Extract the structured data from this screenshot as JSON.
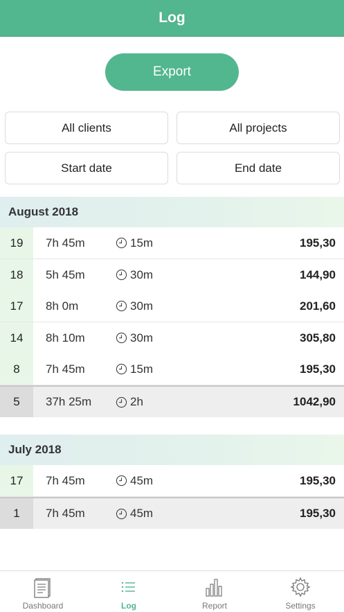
{
  "header": {
    "title": "Log"
  },
  "export_label": "Export",
  "filters": {
    "clients": "All clients",
    "projects": "All projects",
    "start_date": "Start date",
    "end_date": "End date"
  },
  "months": [
    {
      "title": "August 2018",
      "entries": [
        {
          "day": "19",
          "duration": "7h 45m",
          "break": "15m",
          "amount": "195,30"
        },
        {
          "day": "18",
          "duration": "5h 45m",
          "break": "30m",
          "amount": "144,90"
        },
        {
          "day": "17",
          "duration": "8h 0m",
          "break": "30m",
          "amount": "201,60"
        },
        {
          "day": "14",
          "duration": "8h 10m",
          "break": "30m",
          "amount": "305,80"
        },
        {
          "day": "8",
          "duration": "7h 45m",
          "break": "15m",
          "amount": "195,30"
        }
      ],
      "total": {
        "count": "5",
        "duration": "37h 25m",
        "break": "2h",
        "amount": "1042,90"
      }
    },
    {
      "title": "July 2018",
      "entries": [
        {
          "day": "17",
          "duration": "7h 45m",
          "break": "45m",
          "amount": "195,30"
        }
      ],
      "total": {
        "count": "1",
        "duration": "7h 45m",
        "break": "45m",
        "amount": "195,30"
      }
    }
  ],
  "tabs": [
    {
      "label": "Dashboard",
      "icon": "document-icon"
    },
    {
      "label": "Log",
      "icon": "list-icon",
      "active": true
    },
    {
      "label": "Report",
      "icon": "bar-chart-icon"
    },
    {
      "label": "Settings",
      "icon": "gear-icon"
    }
  ],
  "colors": {
    "accent": "#52b68e",
    "day_cell": "#e8f6e8",
    "total_row": "#eeeeee"
  }
}
